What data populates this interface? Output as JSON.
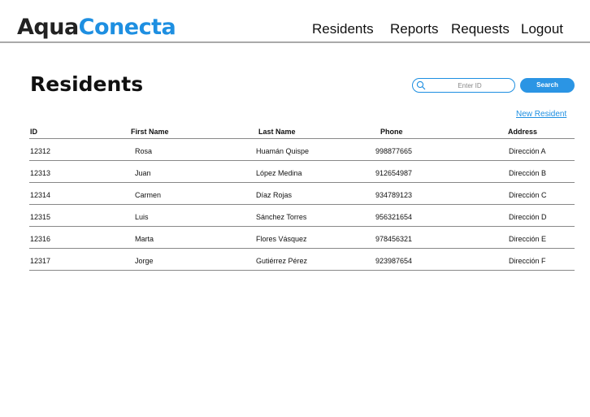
{
  "brand": {
    "part1": "Aqua",
    "part2": "Conecta"
  },
  "nav": {
    "residents": "Residents",
    "reports": "Reports",
    "requests": "Requests",
    "logout": "Logout"
  },
  "page_title": "Residents",
  "search": {
    "placeholder": "Enter ID",
    "button_label": "Search"
  },
  "new_resident_label": "New Resident",
  "table": {
    "headers": [
      "ID",
      "First Name",
      "Last Name",
      "Phone",
      "Address"
    ],
    "rows": [
      [
        "12312",
        "Rosa",
        "Huamán Quispe",
        "998877665",
        "Dirección A"
      ],
      [
        "12313",
        "Juan",
        "López Medina",
        "912654987",
        "Dirección B"
      ],
      [
        "12314",
        "Carmen",
        "Díaz Rojas",
        "934789123",
        "Dirección C"
      ],
      [
        "12315",
        "Luis",
        "Sánchez Torres",
        "956321654",
        "Dirección D"
      ],
      [
        "12316",
        "Marta",
        "Flores Vásquez",
        "978456321",
        "Dirección E"
      ],
      [
        "12317",
        "Jorge",
        "Gutiérrez Pérez",
        "923987654",
        "Dirección F"
      ]
    ]
  },
  "colors": {
    "accent": "#1e8fe1",
    "button": "#2b95e4",
    "text": "#111111"
  }
}
